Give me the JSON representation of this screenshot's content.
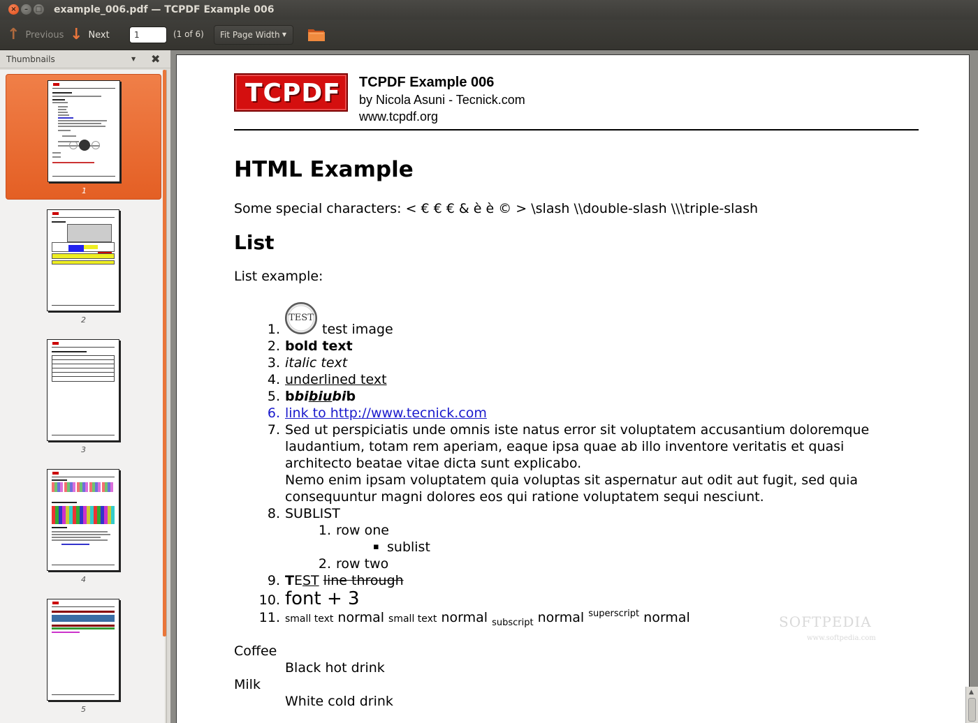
{
  "window": {
    "title": "example_006.pdf — TCPDF Example 006",
    "close": "×",
    "minimize": "–",
    "maximize": "□"
  },
  "toolbar": {
    "previous_label": "Previous",
    "next_label": "Next",
    "previous_icon": "↑",
    "next_icon": "↓",
    "page_value": "1",
    "page_count": "(1 of 6)",
    "zoom_value": "Fit Page Width",
    "zoom_caret": "▼"
  },
  "sidebar": {
    "title": "Thumbnails",
    "dropdown": "▼",
    "close": "✖",
    "thumbnails": [
      {
        "label": "1",
        "selected": true
      },
      {
        "label": "2",
        "selected": false
      },
      {
        "label": "3",
        "selected": false
      },
      {
        "label": "4",
        "selected": false
      },
      {
        "label": "5",
        "selected": false
      }
    ]
  },
  "document": {
    "logo_text": "TCPDF",
    "header_title": "TCPDF Example 006",
    "header_author": "by Nicola Asuni - Tecnick.com",
    "header_url": "www.tcpdf.org",
    "heading": "HTML Example",
    "special_chars": "Some special characters: < € € € & è è © > \\slash \\\\double-slash \\\\\\triple-slash",
    "list_heading": "List",
    "list_intro": "List example:",
    "test_image_text": "TEST",
    "items": {
      "n1": "1.",
      "t1": "test image",
      "n2": "2.",
      "t2": "bold text",
      "n3": "3.",
      "t3": "italic text",
      "n4": "4.",
      "t4": "underlined text",
      "n5": "5.",
      "t5_a": "b",
      "t5_b": "bi",
      "t5_c": "biu",
      "t5_d": "bi",
      "t5_e": "b",
      "n6": "6.",
      "t6": "link to http://www.tecnick.com",
      "n7": "7.",
      "t7_l1": "Sed ut perspiciatis unde omnis iste natus error sit voluptatem accusantium doloremque",
      "t7_l2": "laudantium, totam rem aperiam, eaque ipsa quae ab illo inventore veritatis et quasi",
      "t7_l3": "architecto beatae vitae dicta sunt explicabo.",
      "t7_l4": "Nemo enim ipsam voluptatem quia voluptas sit aspernatur aut odit aut fugit, sed quia",
      "t7_l5": "consequuntur magni dolores eos qui ratione voluptatem sequi nesciunt.",
      "n8": "8.",
      "t8": "SUBLIST",
      "s1_num": "1.",
      "s1": "row one",
      "bullet": "▪",
      "s_bullet": "sublist",
      "s2_num": "2.",
      "s2": "row two",
      "n9": "9.",
      "t9_a": "T",
      "t9_b": "E",
      "t9_c": "S",
      "t9_d": "T",
      "t9_e": "line through",
      "n10": "10.",
      "t10": "font + 3",
      "n11": "11.",
      "t11_a": "small text",
      "t11_b": "normal",
      "t11_c": "small text",
      "t11_d": "normal",
      "t11_e": "subscript",
      "t11_f": "normal",
      "t11_g": "superscript",
      "t11_h": "normal"
    },
    "dl": {
      "term1": "Coffee",
      "def1": "Black hot drink",
      "term2": "Milk",
      "def2": "White cold drink"
    },
    "watermark": "SOFTPEDIA",
    "watermark_sub": "www.softpedia.com"
  },
  "colors": {
    "accent": "#e8672f",
    "link": "#1a1acc",
    "logo_red": "#d40f0f"
  }
}
